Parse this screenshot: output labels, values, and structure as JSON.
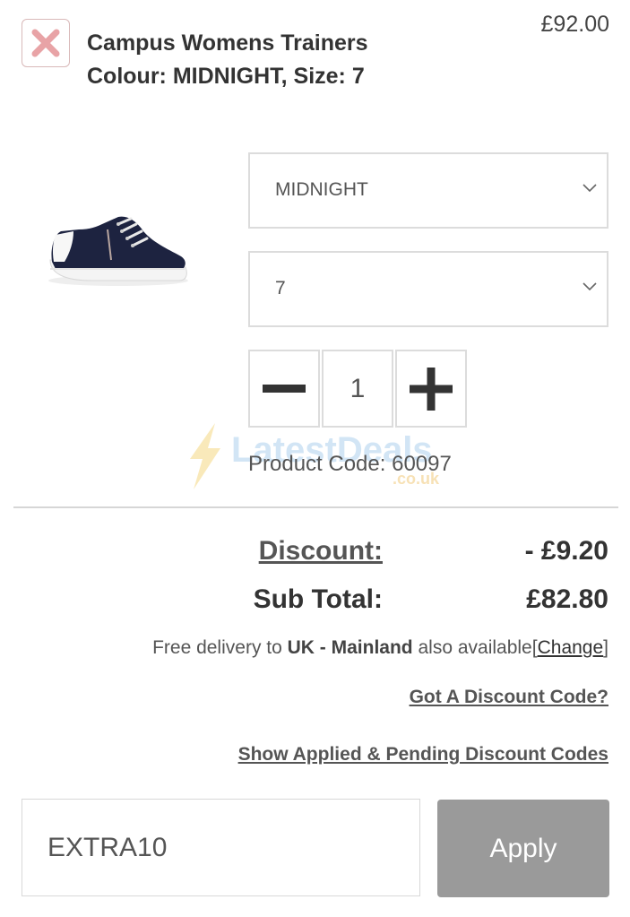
{
  "cart_item": {
    "remove_icon": "close-icon",
    "title": "Campus Womens Trainers",
    "subtitle": "Colour: MIDNIGHT, Size: 7",
    "price": "£92.00",
    "image_icon": "sneaker-image",
    "colour_select": {
      "value": "MIDNIGHT",
      "icon": "chevron-down-icon"
    },
    "size_select": {
      "value": "7",
      "icon": "chevron-down-icon"
    },
    "quantity": {
      "value": "1",
      "decrement_icon": "minus-icon",
      "increment_icon": "plus-icon"
    },
    "product_code": "Product Code: 60097"
  },
  "watermark": {
    "text": "LatestDeals",
    "suffix": ".co.uk"
  },
  "totals": {
    "discount_label": "Discount:",
    "discount_value": "- £9.20",
    "subtotal_label": "Sub Total:",
    "subtotal_value": "£82.80"
  },
  "delivery": {
    "prefix": "Free delivery to",
    "region": "UK - Mainland",
    "suffix": "also available",
    "bracket_open": "[",
    "change_label": "Change",
    "bracket_close": "]"
  },
  "discount": {
    "got_code_label": "Got A Discount Code?",
    "show_applied_label": "Show Applied & Pending Discount Codes",
    "code_value": "EXTRA10",
    "apply_label": "Apply"
  },
  "colors": {
    "remove_icon": "#e8a3a6",
    "border": "#dcdcdc",
    "apply_button": "#9a9a9a"
  }
}
